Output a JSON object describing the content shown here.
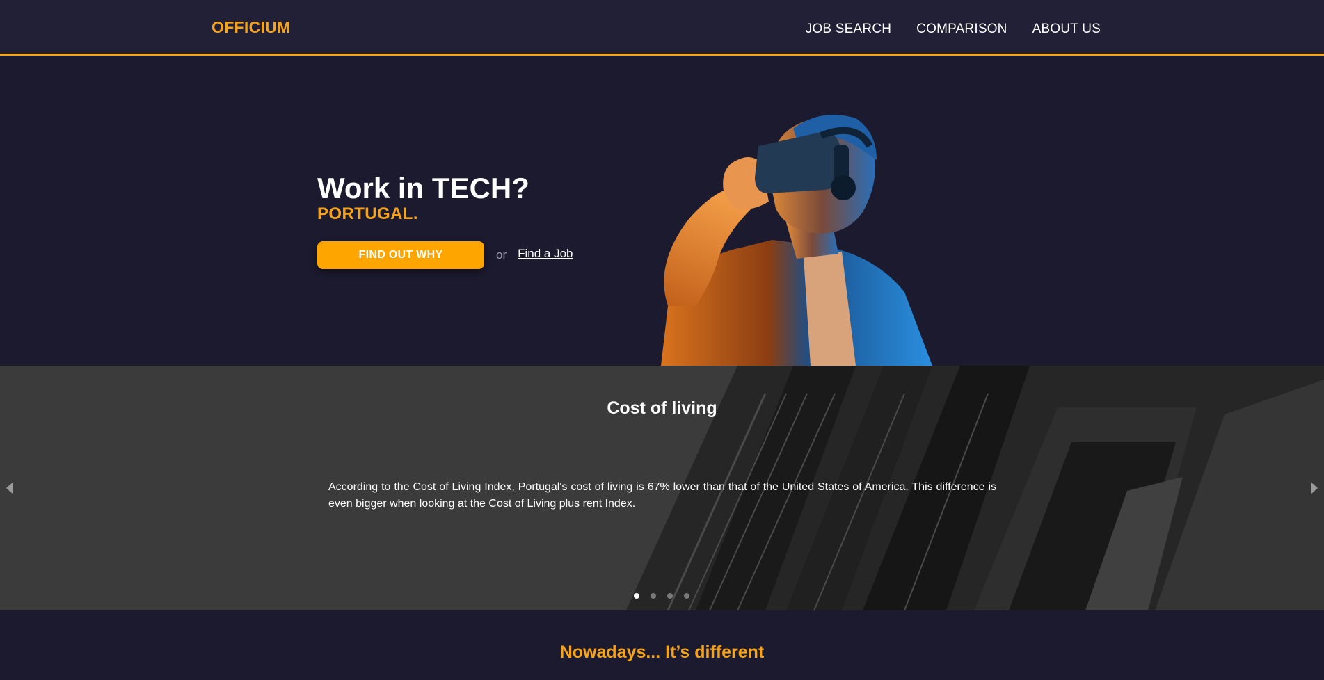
{
  "header": {
    "logo": "OFFICIUM",
    "nav": [
      {
        "label": "JOB SEARCH"
      },
      {
        "label": "COMPARISON"
      },
      {
        "label": "ABOUT US"
      }
    ]
  },
  "hero": {
    "title": "Work in TECH?",
    "subtitle": "PORTUGAL.",
    "cta_button": "FIND OUT WHY",
    "or_text": "or",
    "link_text": "Find a Job",
    "image_icon": "vr-headset-person-image"
  },
  "carousel": {
    "title": "Cost of living",
    "text": "According to the Cost of Living Index, Portugal's cost of living is 67% lower than that of the United States of America. This difference is even bigger when looking at the Cost of Living plus rent Index.",
    "slide_count": 4,
    "active_slide": 1,
    "background_icon": "building-facade-image"
  },
  "section": {
    "heading": "Nowadays... It’s different"
  },
  "colors": {
    "accent": "#f5a31a",
    "button": "#ffa500",
    "background": "#1c1a2e",
    "header_bg": "#222036",
    "carousel_bg": "#3b3b3b"
  }
}
